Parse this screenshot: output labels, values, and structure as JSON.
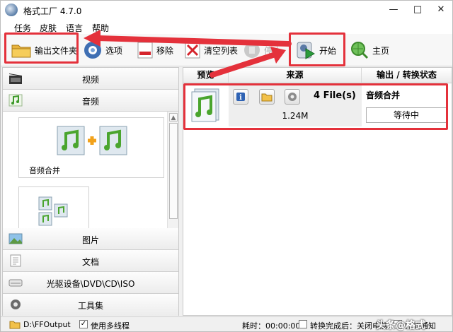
{
  "window": {
    "title": "格式工厂 4.7.0",
    "controls": [
      "—",
      "□",
      "✕"
    ]
  },
  "menu": [
    "任务",
    "皮肤",
    "语言",
    "帮助"
  ],
  "toolbar": {
    "output_folder": "输出文件夹",
    "options": "选项",
    "remove": "移除",
    "clear_list": "清空列表",
    "stop": "停止",
    "start": "开始",
    "home": "主页"
  },
  "categories": {
    "video": "视频",
    "audio": "音频",
    "picture": "图片",
    "document": "文档",
    "disc": "光驱设备\\DVD\\CD\\ISO",
    "tools": "工具集"
  },
  "audio_items": [
    {
      "label": "音频合并"
    }
  ],
  "task_table": {
    "headers": [
      "预览",
      "来源",
      "输出 / 转换状态"
    ],
    "rows": [
      {
        "files": "4 File(s)",
        "size": "1.24M",
        "output": "音频合并",
        "status": "等待中"
      }
    ]
  },
  "statusbar": {
    "output_path": "D:\\FFOutput",
    "multithread": "使用多线程",
    "multithread_checked": true,
    "elapsed": "耗时：00:00:00",
    "after_done": "转换完成后：关闭电脑",
    "after_done_checked": false,
    "notify": "完成通知",
    "notify_checked": true
  },
  "watermark": "头条@格式",
  "colors": {
    "highlight": "#e4313b",
    "arrow": "#e4313b",
    "music_green": "#4aa52e"
  }
}
